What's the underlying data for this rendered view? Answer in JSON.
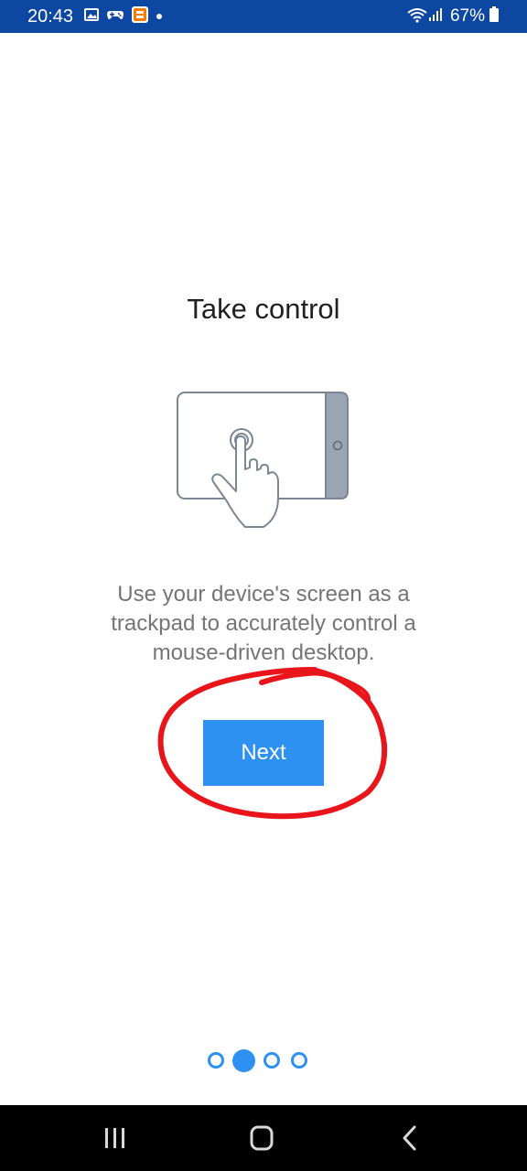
{
  "status_bar": {
    "time": "20:43",
    "battery": "67%",
    "icons": [
      "gallery-icon",
      "gamepad-icon",
      "app-notification-icon",
      "dot-icon",
      "wifi-icon",
      "signal-icon",
      "battery-icon"
    ]
  },
  "onboarding": {
    "title": "Take control",
    "illustration": "tablet-with-hand-icon",
    "description": "Use your device's screen as a\ntrackpad to accurately control a\nmouse-driven desktop.",
    "next_label": "Next",
    "pager": {
      "total": 4,
      "current": 2
    }
  },
  "colors": {
    "status_bar": "#0d47a1",
    "accent": "#2e90f0",
    "title": "#212121",
    "body_text": "#757575",
    "annotation": "#e8151b",
    "nav_bar": "#000000"
  },
  "nav_bar": {
    "icons": [
      "recent-apps-icon",
      "home-icon",
      "back-icon"
    ]
  }
}
